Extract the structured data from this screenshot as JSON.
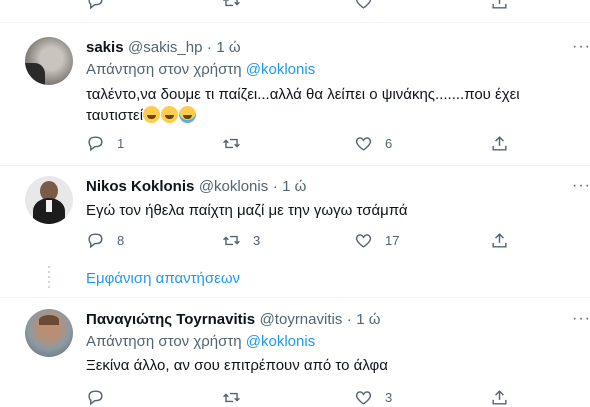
{
  "top_bar": {},
  "tweets": [
    {
      "name": "sakis",
      "handle": "@sakis_hp",
      "time": "1 ώ",
      "reply_prefix": "Απάντηση στον χρήστη",
      "reply_mention": "@koklonis",
      "text_line1": "ταλέντο,να δουμε τι παίζει...αλλά θα  λείπει ο ψινάκης.......που έχει",
      "text_line2": "ταυτιστεί",
      "replies": "1",
      "retweets": "",
      "likes": "6"
    },
    {
      "name": "Nikos Koklonis",
      "handle": "@koklonis",
      "time": "1 ώ",
      "text_line1": "Εγώ τον ήθελα παίχτη μαζί με την γωγω τσάμπά",
      "replies": "8",
      "retweets": "3",
      "likes": "17"
    },
    {
      "name": "Παναγιώτης Toyrnavitis",
      "handle": "@toyrnavitis",
      "time": "1 ώ",
      "reply_prefix": "Απάντηση στον χρήστη",
      "reply_mention": "@koklonis",
      "text_line1": "Ξεκίνα άλλο,  αν σου επιτρέπουν από το άλφα",
      "replies": "",
      "retweets": "",
      "likes": "3"
    }
  ],
  "show_replies": "Εμφάνιση απαντήσεων",
  "more_glyph": "···",
  "colors": {
    "accent": "#1d9bf0",
    "muted": "#536471",
    "text": "#0f1419"
  }
}
